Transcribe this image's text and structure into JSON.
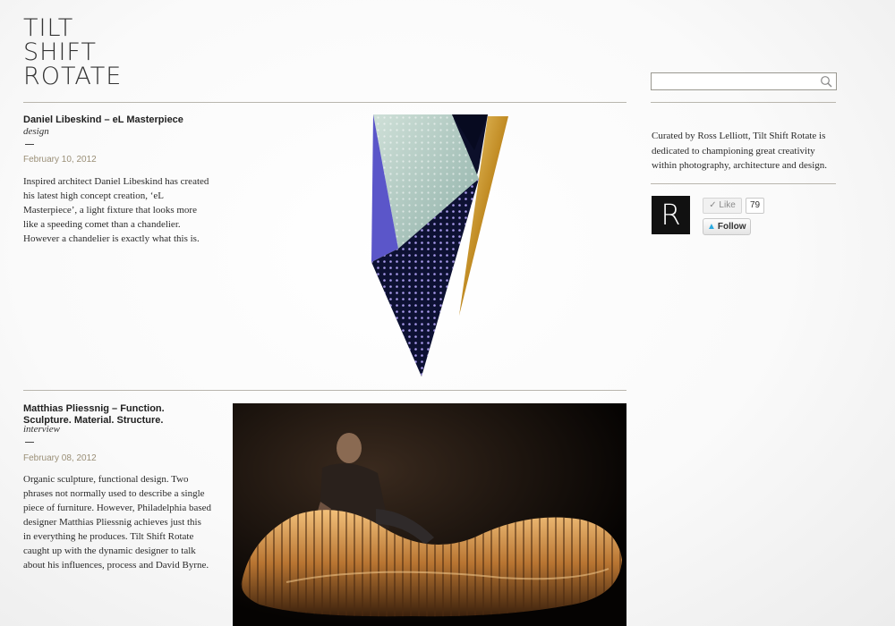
{
  "site": {
    "logo_lines": [
      "TILT",
      "SHIFT",
      "ROTATE"
    ]
  },
  "search": {
    "value": "",
    "placeholder": ""
  },
  "posts": [
    {
      "title_lines": [
        "Daniel Libeskind – eL Masterpiece"
      ],
      "category": "design",
      "date": "February 10, 2012",
      "body": "Inspired architect Daniel Libeskind has created his latest high concept creation, ‘eL Masterpiece’, a light fixture that looks more like a speeding comet than a chandelier. However a chandelier is exactly what this is."
    },
    {
      "title_lines": [
        "Matthias Pliessnig – Function.",
        "Sculpture. Material. Structure."
      ],
      "category": "interview",
      "date": "February 08, 2012",
      "body": "Organic sculpture, functional design. Two phrases not normally used to describe a single piece of furniture. However, Philadelphia based designer Matthias Pliessnig achieves just this in everything he produces. Tilt Shift Rotate caught up with the dynamic designer to talk about his influences, process and David Byrne."
    }
  ],
  "sidebar": {
    "about": "Curated by Ross Lelliott, Tilt Shift Rotate is dedicated to championing great creativity within photography, architecture and design.",
    "avatar_letter": "R",
    "like_label": "Like",
    "like_count": "79",
    "follow_label": "Follow"
  },
  "colors": {
    "accent_date": "#9a8f77",
    "rule": "#b9b6ae",
    "twitter_blue": "#2aa9e0"
  }
}
